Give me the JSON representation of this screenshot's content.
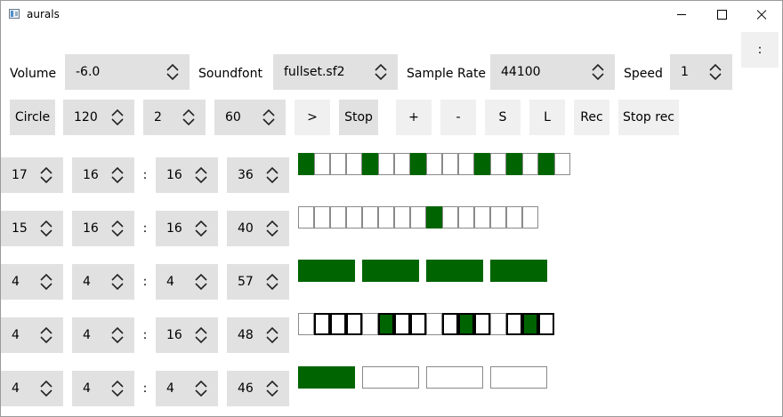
{
  "window": {
    "title": "aurals"
  },
  "toolbar": {
    "menu_label": ":",
    "volume_label": "Volume",
    "volume_value": "-6.0",
    "soundfont_label": "Soundfont",
    "soundfont_value": "fullset.sf2",
    "sample_rate_label": "Sample Rate",
    "sample_rate_value": "44100",
    "speed_label": "Speed",
    "speed_value": "1"
  },
  "controls": {
    "mode_label": "Circle",
    "tempo": "120",
    "param2": "2",
    "param3": "60",
    "play_label": ">",
    "stop_label": "Stop",
    "add_label": "+",
    "remove_label": "-",
    "save_label": "S",
    "load_label": "L",
    "rec_label": "Rec",
    "stop_rec_label": "Stop rec"
  },
  "tracks": [
    {
      "a": "17",
      "b": "16",
      "sep": ":",
      "c": "16",
      "d": "36",
      "cells": [
        1,
        0,
        0,
        0,
        1,
        0,
        0,
        1,
        0,
        0,
        0,
        1,
        0,
        1,
        0,
        1,
        0
      ],
      "marked": []
    },
    {
      "a": "15",
      "b": "16",
      "sep": ":",
      "c": "16",
      "d": "40",
      "cells": [
        0,
        0,
        0,
        0,
        0,
        0,
        0,
        0,
        1,
        0,
        0,
        0,
        0,
        0,
        0
      ],
      "marked": []
    },
    {
      "a": "4",
      "b": "4",
      "sep": ":",
      "c": "4",
      "d": "57",
      "cells": [
        1,
        1,
        1,
        1
      ],
      "marked": []
    },
    {
      "a": "4",
      "b": "4",
      "sep": ":",
      "c": "16",
      "d": "48",
      "cells": [
        0,
        0,
        0,
        0,
        0,
        1,
        0,
        0,
        0,
        0,
        1,
        0,
        0,
        0,
        1,
        0
      ],
      "marked": [
        1,
        2,
        3,
        5,
        6,
        7,
        9,
        10,
        11,
        13,
        14,
        15
      ]
    },
    {
      "a": "4",
      "b": "4",
      "sep": ":",
      "c": "4",
      "d": "46",
      "cells": [
        1,
        0,
        0,
        0
      ],
      "marked": []
    }
  ],
  "colors": {
    "active_cell": "#006400",
    "control_bg": "#e1e1e1"
  }
}
